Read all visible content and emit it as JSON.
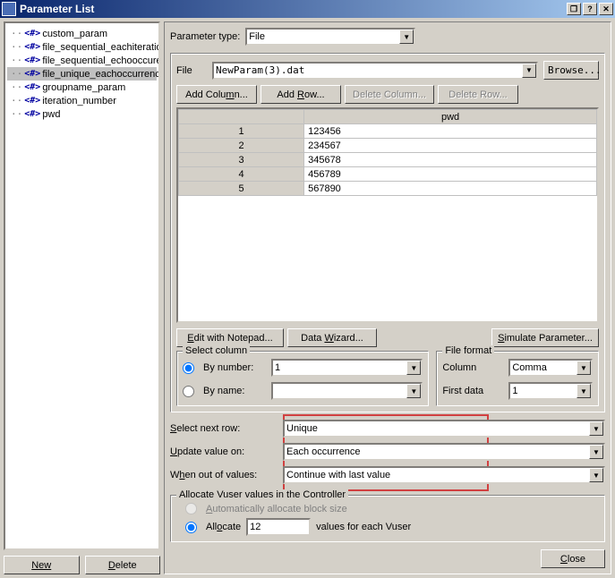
{
  "title": "Parameter List",
  "sidebar": {
    "items": [
      {
        "label": "custom_param",
        "selected": false
      },
      {
        "label": "file_sequential_eachiteration",
        "selected": false
      },
      {
        "label": "file_sequential_echooccurence",
        "selected": false
      },
      {
        "label": "file_unique_eachoccurrence",
        "selected": true
      },
      {
        "label": "groupname_param",
        "selected": false
      },
      {
        "label": "iteration_number",
        "selected": false
      },
      {
        "label": "pwd",
        "selected": false
      }
    ],
    "new_label": "New",
    "delete_label": "Delete"
  },
  "param_type": {
    "label": "Parameter type:",
    "value": "File"
  },
  "file": {
    "label": "File",
    "value": "NewParam(3).dat",
    "browse": "Browse..."
  },
  "table_btns": {
    "add_col": "Add Column...",
    "add_row": "Add Row...",
    "del_col": "Delete Column...",
    "del_row": "Delete Row..."
  },
  "table": {
    "headers": [
      "pwd"
    ],
    "rows": [
      [
        "123456"
      ],
      [
        "234567"
      ],
      [
        "345678"
      ],
      [
        "456789"
      ],
      [
        "567890"
      ]
    ]
  },
  "edit_notepad": "Edit with Notepad...",
  "data_wizard": "Data Wizard...",
  "simulate": "Simulate Parameter...",
  "select_column": {
    "legend": "Select column",
    "by_number": "By number:",
    "by_number_val": "1",
    "by_name": "By name:",
    "by_name_val": ""
  },
  "file_format": {
    "legend": "File format",
    "column": "Column",
    "column_val": "Comma",
    "first_data": "First data",
    "first_data_val": "1"
  },
  "select_next_row": {
    "label": "Select next row:",
    "value": "Unique"
  },
  "update_value_on": {
    "label": "Update value on:",
    "value": "Each occurrence"
  },
  "when_out": {
    "label": "When out of values:",
    "value": "Continue with last value"
  },
  "allocate": {
    "legend": "Allocate Vuser values in the Controller",
    "auto": "Automatically allocate block size",
    "allocate": "Allocate",
    "value": "12",
    "suffix": "values for each Vuser"
  },
  "close": "Close"
}
